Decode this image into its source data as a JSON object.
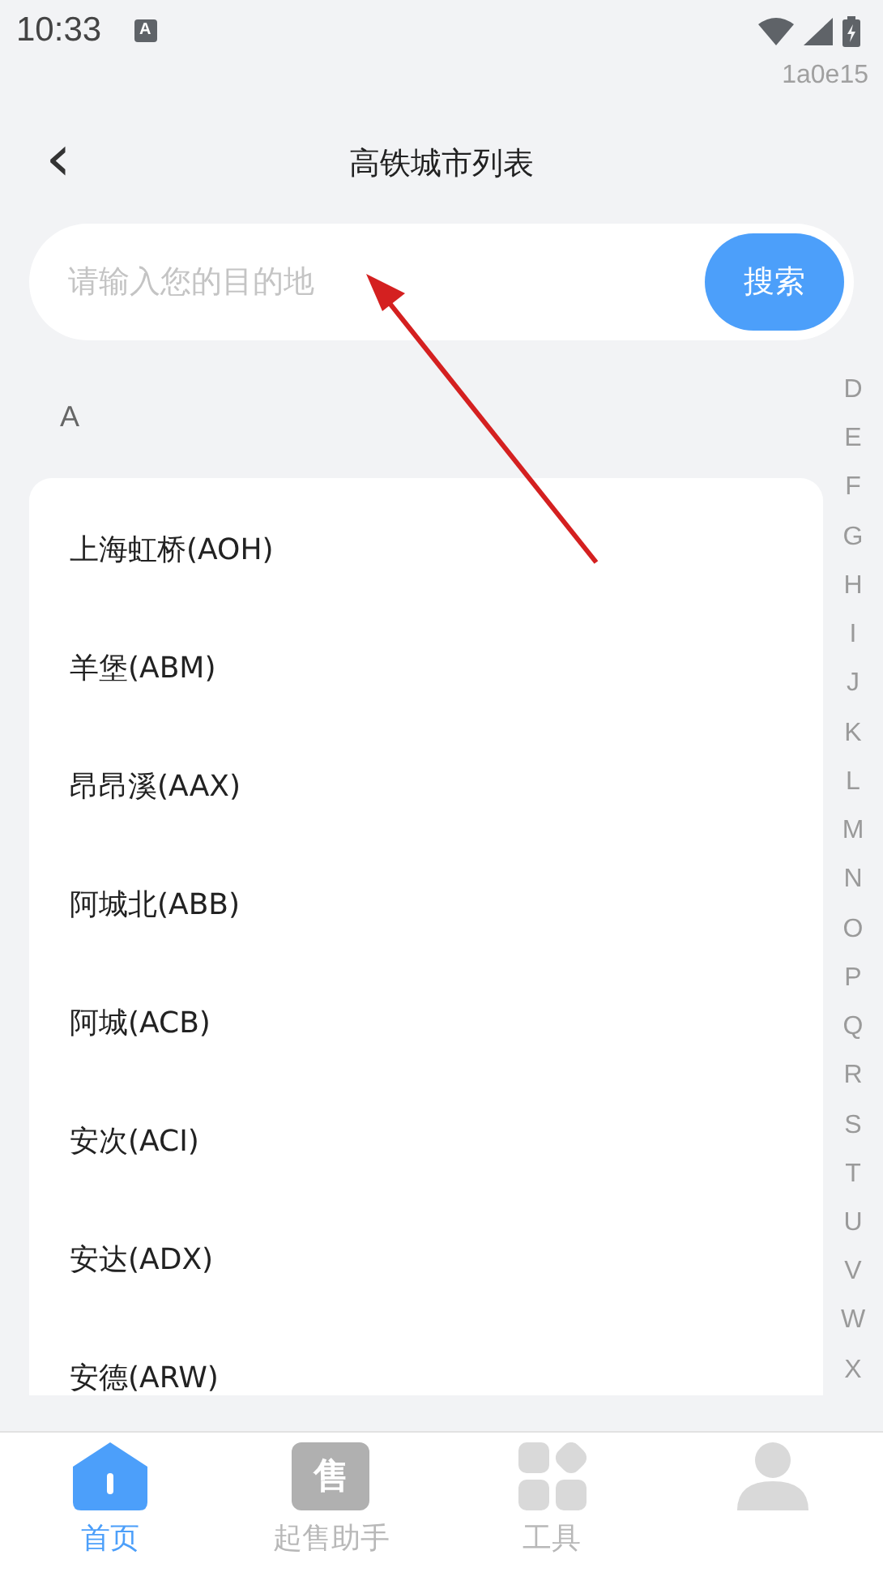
{
  "status_bar": {
    "time": "10:33",
    "notification_glyph": "A"
  },
  "debug_code": "1a0e15",
  "header": {
    "back": "‹",
    "title": "高铁城市列表"
  },
  "search": {
    "placeholder": "请输入您的目的地",
    "button": "搜索"
  },
  "section": {
    "letter": "A",
    "cities": [
      {
        "name": "上海虹桥(AOH)"
      },
      {
        "name": "羊堡(ABM)"
      },
      {
        "name": "昂昂溪(AAX)"
      },
      {
        "name": "阿城北(ABB)"
      },
      {
        "name": "阿城(ACB)"
      },
      {
        "name": "安次(ACI)"
      },
      {
        "name": "安达(ADX)"
      },
      {
        "name": "安德(ARW)"
      }
    ]
  },
  "index_letters": [
    "D",
    "E",
    "F",
    "G",
    "H",
    "I",
    "J",
    "K",
    "L",
    "M",
    "N",
    "O",
    "P",
    "Q",
    "R",
    "S",
    "T",
    "U",
    "V",
    "W",
    "X"
  ],
  "tabs": [
    {
      "kind": "home",
      "label": "首页",
      "selected": true
    },
    {
      "kind": "ticket",
      "label": "起售助手",
      "glyph": "售",
      "selected": false
    },
    {
      "kind": "grid",
      "label": "工具",
      "selected": false
    },
    {
      "kind": "person",
      "selected": false
    }
  ]
}
